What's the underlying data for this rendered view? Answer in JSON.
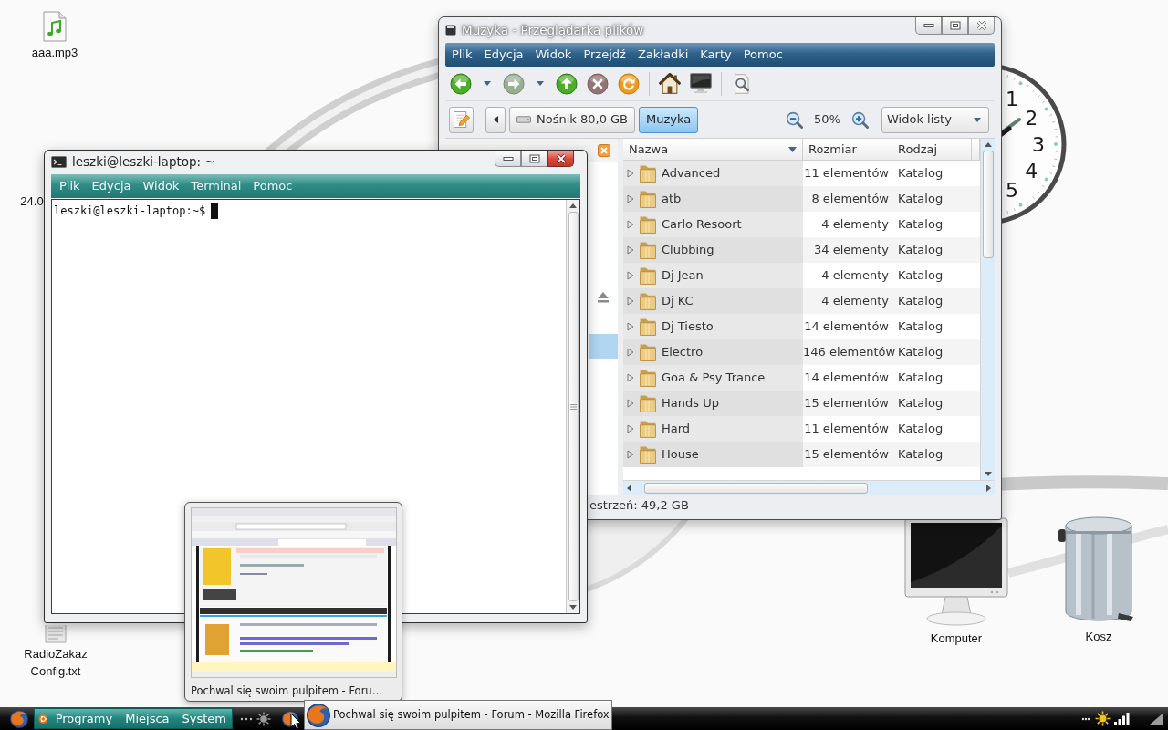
{
  "desktop_icons": [
    {
      "kind": "audio",
      "label": "aaa.mp3"
    },
    {
      "label": "24.0"
    },
    {
      "kind": "text",
      "label": "RadioZakaz Config.txt"
    },
    {
      "kind": "computer",
      "label": "Komputer"
    },
    {
      "kind": "trash",
      "label": "Kosz"
    }
  ],
  "clock": {
    "numerals": [
      "1",
      "2",
      "3",
      "4",
      "5"
    ]
  },
  "file_manager": {
    "title": "Muzyka - Przeglądarka plików",
    "menu": [
      "Plik",
      "Edycja",
      "Widok",
      "Przejdź",
      "Zakładki",
      "Karty",
      "Pomoc"
    ],
    "toolbar": [
      {
        "kind": "back",
        "disabled": false,
        "menu": true,
        "separator_after": false
      },
      {
        "kind": "forward",
        "disabled": true,
        "menu": true,
        "separator_after": false
      },
      {
        "kind": "up",
        "disabled": false,
        "menu": false,
        "separator_after": false
      },
      {
        "kind": "stop",
        "disabled": true,
        "menu": false,
        "separator_after": false
      },
      {
        "kind": "reload",
        "disabled": false,
        "menu": false,
        "separator_after": true
      },
      {
        "kind": "home",
        "disabled": false,
        "menu": false,
        "separator_after": false
      },
      {
        "kind": "computer",
        "disabled": false,
        "menu": false,
        "separator_after": true
      },
      {
        "kind": "search",
        "disabled": false,
        "menu": false,
        "separator_after": false
      }
    ],
    "path": [
      {
        "label": "Nośnik 80,0 GB",
        "kind": "drive",
        "selected": false
      },
      {
        "label": "Muzyka",
        "kind": "folder",
        "selected": true
      }
    ],
    "zoom": "50%",
    "view": "Widok listy",
    "sidebar": {
      "items": [
        {
          "selected": false,
          "eject": false
        },
        {
          "selected": false,
          "eject": false
        },
        {
          "selected": false,
          "eject": false
        },
        {
          "selected": false,
          "eject": false
        },
        {
          "selected": false,
          "eject": false
        },
        {
          "selected": false,
          "eject": true
        },
        {
          "selected": false,
          "eject": false
        },
        {
          "selected": true,
          "eject": false
        },
        {
          "selected": false,
          "eject": false
        }
      ]
    },
    "columns": [
      {
        "label": "Nazwa",
        "sorted": true
      },
      {
        "label": "Rozmiar",
        "sorted": false
      },
      {
        "label": "Rodzaj",
        "sorted": false
      }
    ],
    "rows": [
      {
        "name": "Advanced",
        "size": "11 elementów",
        "type": "Katalog",
        "expanded": false,
        "selected": false
      },
      {
        "name": "atb",
        "size": "8 elementów",
        "type": "Katalog",
        "expanded": false,
        "selected": false
      },
      {
        "name": "Carlo Resoort",
        "size": "4 elementy",
        "type": "Katalog",
        "expanded": false,
        "selected": false
      },
      {
        "name": "Clubbing",
        "size": "34 elementy",
        "type": "Katalog",
        "expanded": false,
        "selected": false
      },
      {
        "name": "Dj Jean",
        "size": "4 elementy",
        "type": "Katalog",
        "expanded": false,
        "selected": false
      },
      {
        "name": "Dj KC",
        "size": "4 elementy",
        "type": "Katalog",
        "expanded": false,
        "selected": false
      },
      {
        "name": "Dj Tiesto",
        "size": "14 elementów",
        "type": "Katalog",
        "expanded": false,
        "selected": false
      },
      {
        "name": "Electro",
        "size": "146 elementów",
        "type": "Katalog",
        "expanded": false,
        "selected": false
      },
      {
        "name": "Goa & Psy Trance",
        "size": "14 elementów",
        "type": "Katalog",
        "expanded": false,
        "selected": false
      },
      {
        "name": "Hands Up",
        "size": "15 elementów",
        "type": "Katalog",
        "expanded": false,
        "selected": false
      },
      {
        "name": "Hard",
        "size": "11 elementów",
        "type": "Katalog",
        "expanded": false,
        "selected": false
      },
      {
        "name": "House",
        "size": "15 elementów",
        "type": "Katalog",
        "expanded": false,
        "selected": false
      }
    ],
    "status": "estrzeń: 49,2 GB"
  },
  "terminal": {
    "title": "leszki@leszki-laptop: ~",
    "menu": [
      "Plik",
      "Edycja",
      "Widok",
      "Terminal",
      "Pomoc"
    ],
    "prompt": "leszki@leszki-laptop:~$"
  },
  "preview": {
    "caption": "Pochwal się swoim pulpitem - Foru…"
  },
  "taskbar": {
    "menus": [
      "Programy",
      "Miejsca",
      "System"
    ],
    "tasks": [
      {
        "title": "Pochwal się swoim pulpitem - Forum - Mozilla Firefox",
        "selected": true
      }
    ]
  }
}
